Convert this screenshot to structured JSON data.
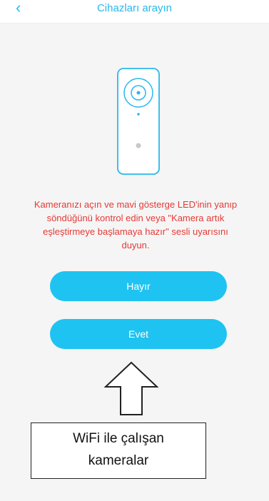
{
  "header": {
    "back_glyph": "‹",
    "title": "Cihazları arayın"
  },
  "illustration": {
    "name": "camera-illustration",
    "accent_color": "#29b8ec"
  },
  "message": {
    "text": "Kameranızı açın ve mavi gösterge LED'inin yanıp söndüğünü kontrol edin veya \"Kamera artık eşleştirmeye başlamaya hazır\" sesli uyarısını duyun.",
    "color": "#e53935"
  },
  "buttons": {
    "no_label": "Hayır",
    "yes_label": "Evet",
    "color": "#1ec3f1"
  },
  "annotation": {
    "line1": "WiFi ile çalışan",
    "line2": "kameralar"
  }
}
